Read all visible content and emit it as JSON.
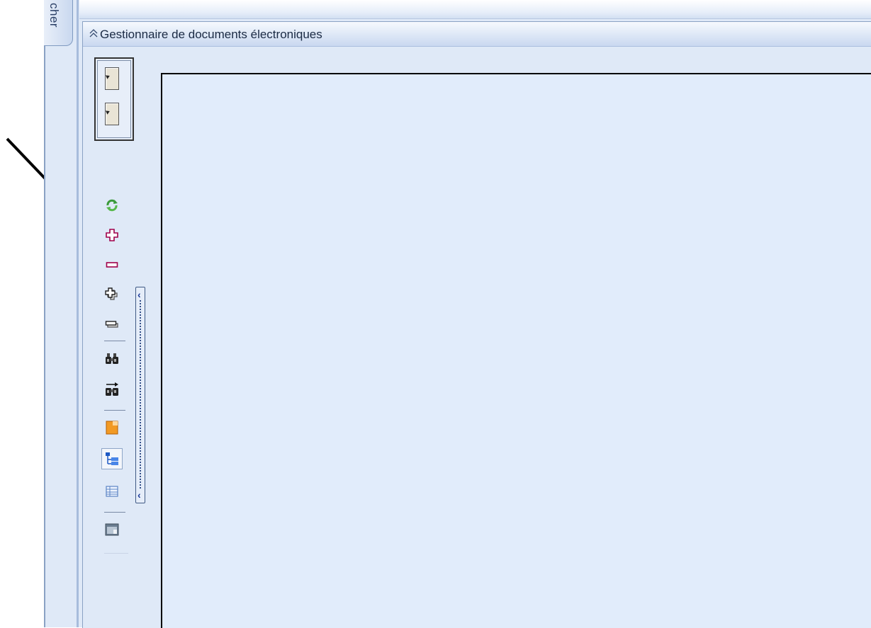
{
  "window": {
    "side_tab_label": "cher",
    "panel_title": "Gestionnaire de documents électroniques"
  },
  "toolbar": {
    "buttons": [
      {
        "id": "refresh",
        "icon": "refresh-icon",
        "color": "#3a9a3a"
      },
      {
        "id": "add",
        "icon": "plus-icon",
        "color": "#a0004a"
      },
      {
        "id": "remove",
        "icon": "minus-icon",
        "color": "#a0004a"
      },
      {
        "id": "add-multiple",
        "icon": "plus-multiple-icon"
      },
      {
        "id": "remove-multiple",
        "icon": "minus-multiple-icon"
      },
      {
        "id": "search",
        "icon": "binoculars-icon"
      },
      {
        "id": "search-next",
        "icon": "binoculars-next-icon"
      },
      {
        "id": "document",
        "icon": "orange-document-icon",
        "color": "#f0901c"
      },
      {
        "id": "tree-view",
        "icon": "tree-view-icon",
        "active": true
      },
      {
        "id": "table-view",
        "icon": "table-view-icon"
      },
      {
        "id": "preview",
        "icon": "preview-window-icon"
      }
    ]
  },
  "colors": {
    "panel_background": "#dfe9f7",
    "content_background": "#e1ecfb",
    "header_text": "#1a2a44"
  }
}
